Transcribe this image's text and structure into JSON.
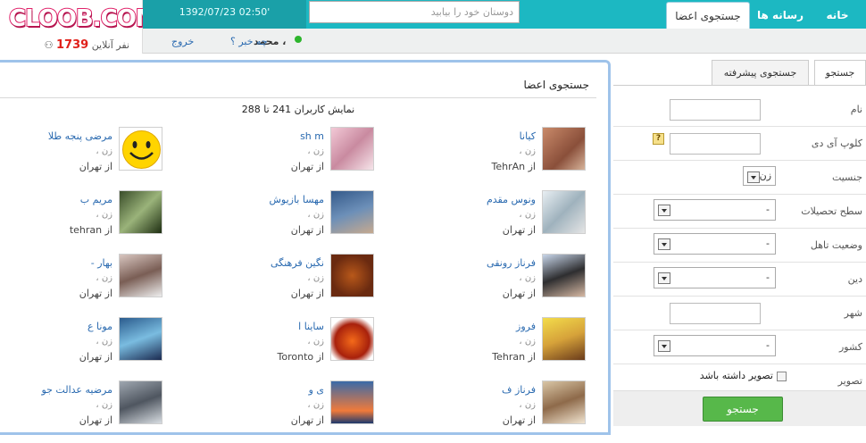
{
  "brand": {
    "logo_text": "CLOOB.COM",
    "online_count": "1739",
    "online_label": "نفر آنلاین"
  },
  "header": {
    "datetime": "1392/07/23 02:50'",
    "search_placeholder": "دوستان خود را بیابید",
    "tabs": {
      "search": "جستجوی اعضا",
      "media": "رسانه ها",
      "home": "خانه"
    }
  },
  "userbar": {
    "username": "محمد ،",
    "whatsnew": "چه خبر ؟",
    "logout": "خروج"
  },
  "results": {
    "title": "جستجوی اعضا",
    "paging": "نمایش کاربران 241 تا 288",
    "cards": [
      {
        "name": "کیانا",
        "sex": "زن ،",
        "city": "از TehrAn",
        "photo": "photo-kiana"
      },
      {
        "name": "sh m",
        "sex": "زن ،",
        "city": "از تهران",
        "photo": "photo-shm"
      },
      {
        "name": "مرضی پنجه طلا",
        "sex": "زن ،",
        "city": "از تهران",
        "photo": "smiley-icon"
      },
      {
        "name": "ونوس مقدم",
        "sex": "زن ،",
        "city": "از تهران",
        "photo": "photo-venus"
      },
      {
        "name": "مهسا بازیوش",
        "sex": "زن ،",
        "city": "از تهران",
        "photo": "photo-mahsa"
      },
      {
        "name": "مریم ب",
        "sex": "زن ،",
        "city": "از tehran",
        "photo": "photo-maryam"
      },
      {
        "name": "فرناز رونقی",
        "sex": "زن ،",
        "city": "از تهران",
        "photo": "photo-farnaz"
      },
      {
        "name": "نگین فرهنگی",
        "sex": "زن ،",
        "city": "از تهران",
        "photo": "photo-negin"
      },
      {
        "name": "بهار -",
        "sex": "زن ،",
        "city": "از تهران",
        "photo": "photo-bahar"
      },
      {
        "name": "فروز",
        "sex": "زن ،",
        "city": "از Tehran",
        "photo": "photo-foruz"
      },
      {
        "name": "ساینا ا",
        "sex": "زن ،",
        "city": "از Toronto",
        "photo": "photo-saina"
      },
      {
        "name": "مونا ع",
        "sex": "زن ،",
        "city": "از تهران",
        "photo": "photo-mona"
      },
      {
        "name": "فرناز ف",
        "sex": "زن ،",
        "city": "از تهران",
        "photo": "photo-farnazf"
      },
      {
        "name": "ی و",
        "sex": "زن ،",
        "city": "از تهران",
        "photo": "photo-yv"
      },
      {
        "name": "مرضیه عدالت جو",
        "sex": "زن ،",
        "city": "از تهران",
        "photo": "photo-marzieh"
      }
    ]
  },
  "sidebar": {
    "tabs": {
      "simple": "جستجو",
      "advanced": "جستجوی پیشرفته"
    },
    "fields": {
      "name": "نام",
      "cloob_id": "کلوپ آی دی",
      "gender": "جنسیت",
      "gender_value": "زن",
      "education": "سطح تحصیلات",
      "education_value": "-",
      "marital": "وضعیت تاهل",
      "marital_value": "-",
      "religion": "دین",
      "religion_value": "-",
      "city": "شهر",
      "country": "کشور",
      "country_value": "-",
      "photo": "تصویر",
      "photo_check": "تصویر داشته باشد"
    },
    "submit": "جستجو",
    "help_icon": "?"
  },
  "colors": {
    "accent": "#1cb8c2",
    "link": "#2a6ab0",
    "button": "#57b84a",
    "brand": "#e0226a"
  }
}
